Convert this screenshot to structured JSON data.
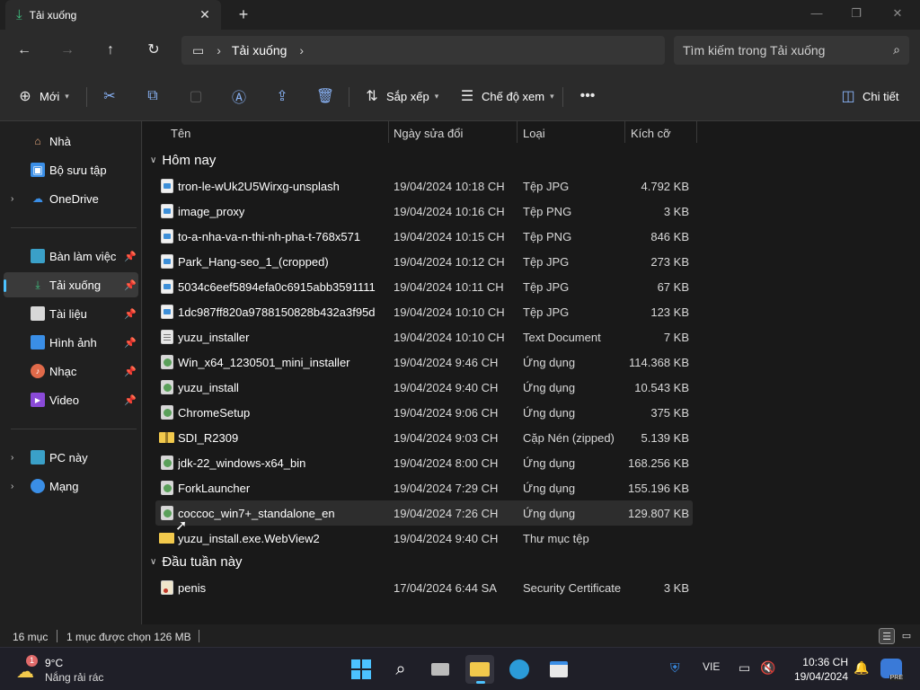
{
  "window": {
    "tab_title": "Tải xuống",
    "close_tab": "✕",
    "new_tab": "+"
  },
  "address": {
    "crumbs": [
      "Tải xuống"
    ],
    "search_placeholder": "Tìm kiếm trong Tải xuống"
  },
  "commands": {
    "new_label": "Mới",
    "sort_label": "Sắp xếp",
    "view_label": "Chế độ xem",
    "details_label": "Chi tiết"
  },
  "sidebar": {
    "items": [
      {
        "label": "Nhà",
        "icon": "home-icon"
      },
      {
        "label": "Bộ sưu tập",
        "icon": "gallery-icon"
      },
      {
        "label": "OneDrive",
        "icon": "onedrive-icon"
      },
      {
        "label": "Bàn làm việc",
        "icon": "desktop-icon"
      },
      {
        "label": "Tải xuống",
        "icon": "download-icon"
      },
      {
        "label": "Tài liệu",
        "icon": "documents-icon"
      },
      {
        "label": "Hình ảnh",
        "icon": "pictures-icon"
      },
      {
        "label": "Nhạc",
        "icon": "music-icon"
      },
      {
        "label": "Video",
        "icon": "video-icon"
      },
      {
        "label": "PC này",
        "icon": "pc-icon"
      },
      {
        "label": "Mạng",
        "icon": "network-icon"
      }
    ]
  },
  "columns": {
    "name": "Tên",
    "date": "Ngày sửa đổi",
    "type": "Loại",
    "size": "Kích cỡ"
  },
  "groups": {
    "today": "Hôm nay",
    "early_week": "Đầu tuần này"
  },
  "files": [
    {
      "name": "tron-le-wUk2U5Wirxg-unsplash",
      "date": "19/04/2024 10:18 CH",
      "type": "Tệp JPG",
      "size": "4.792 KB",
      "icon": "jpg"
    },
    {
      "name": "image_proxy",
      "date": "19/04/2024 10:16 CH",
      "type": "Tệp PNG",
      "size": "3 KB",
      "icon": "jpg"
    },
    {
      "name": "to-a-nha-va-n-thi-nh-pha-t-768x571",
      "date": "19/04/2024 10:15 CH",
      "type": "Tệp PNG",
      "size": "846 KB",
      "icon": "jpg"
    },
    {
      "name": "Park_Hang-seo_1_(cropped)",
      "date": "19/04/2024 10:12 CH",
      "type": "Tệp JPG",
      "size": "273 KB",
      "icon": "jpg"
    },
    {
      "name": "5034c6eef5894efa0c6915abb3591111",
      "date": "19/04/2024 10:11 CH",
      "type": "Tệp JPG",
      "size": "67 KB",
      "icon": "jpg"
    },
    {
      "name": "1dc987ff820a9788150828b432a3f95d",
      "date": "19/04/2024 10:10 CH",
      "type": "Tệp JPG",
      "size": "123 KB",
      "icon": "jpg"
    },
    {
      "name": "yuzu_installer",
      "date": "19/04/2024 10:10 CH",
      "type": "Text Document",
      "size": "7 KB",
      "icon": "txt"
    },
    {
      "name": "Win_x64_1230501_mini_installer",
      "date": "19/04/2024 9:46 CH",
      "type": "Ứng dụng",
      "size": "114.368 KB",
      "icon": "app"
    },
    {
      "name": "yuzu_install",
      "date": "19/04/2024 9:40 CH",
      "type": "Ứng dụng",
      "size": "10.543 KB",
      "icon": "app"
    },
    {
      "name": "ChromeSetup",
      "date": "19/04/2024 9:06 CH",
      "type": "Ứng dụng",
      "size": "375 KB",
      "icon": "app"
    },
    {
      "name": "SDI_R2309",
      "date": "19/04/2024 9:03 CH",
      "type": "Cặp Nén (zipped)",
      "size": "5.139 KB",
      "icon": "zip"
    },
    {
      "name": "jdk-22_windows-x64_bin",
      "date": "19/04/2024 8:00 CH",
      "type": "Ứng dụng",
      "size": "168.256 KB",
      "icon": "app"
    },
    {
      "name": "ForkLauncher",
      "date": "19/04/2024 7:29 CH",
      "type": "Ứng dụng",
      "size": "155.196 KB",
      "icon": "app"
    },
    {
      "name": "coccoc_win7+_standalone_en",
      "date": "19/04/2024 7:26 CH",
      "type": "Ứng dụng",
      "size": "129.807 KB",
      "icon": "app"
    },
    {
      "name": "yuzu_install.exe.WebView2",
      "date": "19/04/2024 9:40 CH",
      "type": "Thư mục tệp",
      "size": "",
      "icon": "folder"
    }
  ],
  "files_early": [
    {
      "name": "penis",
      "date": "17/04/2024 6:44 SA",
      "type": "Security Certificate",
      "size": "3 KB",
      "icon": "cert"
    }
  ],
  "status": {
    "count": "16 mục",
    "selection": "1 mục được chọn  126 MB"
  },
  "taskbar": {
    "temp": "9°C",
    "weather": "Nắng rải rác",
    "weather_badge": "1",
    "lang": "VIE",
    "time": "10:36 CH",
    "date": "19/04/2024",
    "copilot_badge": "PRE"
  },
  "colors": {
    "accent": "#4cc2ff",
    "background": "#191919",
    "chrome": "#2b2b2b"
  }
}
